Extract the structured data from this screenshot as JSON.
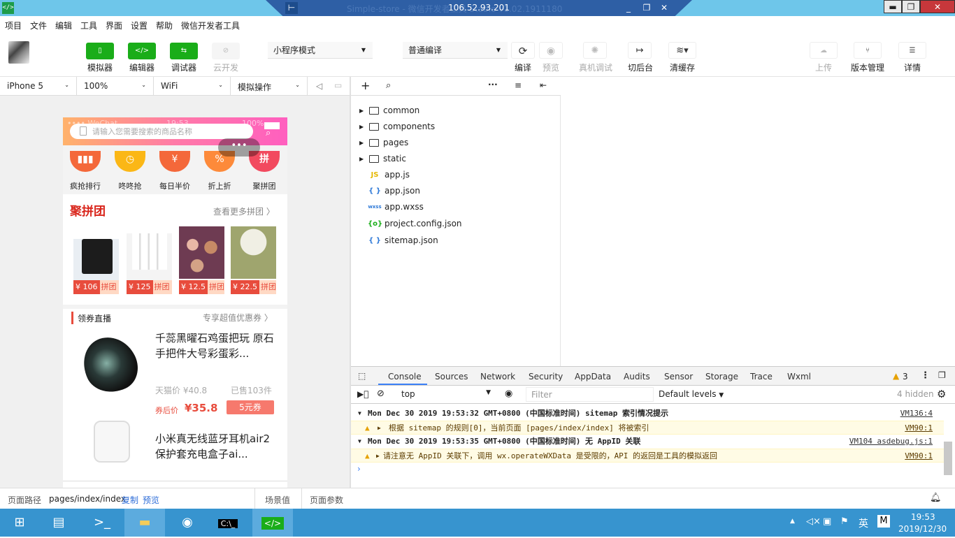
{
  "titlebar": {
    "app_icon": "</>",
    "ghost_title": "Simple-store - 微信开发者工具 Stable v1.02.1911180",
    "rdp_ip": "106.52.93.201",
    "pin_icon": "pin-icon"
  },
  "menu": [
    "项目",
    "文件",
    "编辑",
    "工具",
    "界面",
    "设置",
    "帮助",
    "微信开发者工具"
  ],
  "toolbar": {
    "simulator": "模拟器",
    "editor": "编辑器",
    "debugger": "调试器",
    "cloud": "云开发",
    "mode": "小程序模式",
    "compile_mode": "普通编译",
    "compile": "编译",
    "preview": "预览",
    "remote_debug": "真机调试",
    "background": "切后台",
    "clear_cache": "清缓存",
    "upload": "上传",
    "version": "版本管理",
    "details": "详情"
  },
  "device": {
    "model": "iPhone 5",
    "zoom": "100%",
    "network": "WiFi",
    "operation": "模拟操作"
  },
  "phone": {
    "status_carrier": "•••• WeChat",
    "status_time": "19:53",
    "status_battery": "100%",
    "search_placeholder": "请输入您需要搜索的商品名称",
    "capsule": "•••",
    "categories": [
      {
        "label": "疯抢排行",
        "icon": "fire-icon",
        "color": "#f4683a"
      },
      {
        "label": "咚咚抢",
        "icon": "clock-icon",
        "color": "#fbb716"
      },
      {
        "label": "每日半价",
        "icon": "yen-icon",
        "color": "#f4683a"
      },
      {
        "label": "折上折",
        "icon": "discount-icon",
        "color": "#fd8a3a"
      },
      {
        "label": "聚拼团",
        "icon": "group-icon",
        "color": "#f24a5f"
      }
    ],
    "group_title": "聚拼团",
    "group_more": "查看更多拼团 〉",
    "products": [
      {
        "price": "¥ 106",
        "tag": "拼团",
        "bg": "#e9eef3"
      },
      {
        "price": "¥ 125",
        "tag": "拼团",
        "bg": "#f4f4f4"
      },
      {
        "price": "¥ 12.5",
        "tag": "拼团",
        "bg": "#c9a88a"
      },
      {
        "price": "¥ 22.5",
        "tag": "拼团",
        "bg": "#9fa56e"
      }
    ],
    "live_title": "领券直播",
    "live_more": "专享超值优惠券 〉",
    "item1": {
      "title": "千蕊黑曜石鸡蛋把玩 原石手把件大号彩蛋彩...",
      "tmall": "天猫价 ¥40.8",
      "sold": "已售103件",
      "after_label": "券后价",
      "after_price": "¥35.8",
      "coupon": "5元券"
    },
    "item2": {
      "title": "小米真无线蓝牙耳机air2保护套充电盒子ai..."
    }
  },
  "tree": [
    {
      "type": "folder",
      "name": "common"
    },
    {
      "type": "folder",
      "name": "components"
    },
    {
      "type": "folder",
      "name": "pages"
    },
    {
      "type": "folder",
      "name": "static"
    },
    {
      "type": "file",
      "name": "app.js",
      "icon": "JS",
      "color": "#e6b800"
    },
    {
      "type": "file",
      "name": "app.json",
      "icon": "{ }",
      "color": "#2f7ad8"
    },
    {
      "type": "file",
      "name": "app.wxss",
      "icon": "wxss",
      "color": "#2f7ad8"
    },
    {
      "type": "file",
      "name": "project.config.json",
      "icon": "{o}",
      "color": "#1aad19"
    },
    {
      "type": "file",
      "name": "sitemap.json",
      "icon": "{ }",
      "color": "#2f7ad8"
    }
  ],
  "devtools": {
    "tabs": [
      "Console",
      "Sources",
      "Network",
      "Security",
      "AppData",
      "Audits",
      "Sensor",
      "Storage",
      "Trace",
      "Wxml"
    ],
    "warn_count": "3",
    "context": "top",
    "filter_placeholder": "Filter",
    "levels": "Default levels",
    "hidden": "4 hidden",
    "logs": [
      {
        "kind": "group",
        "text": "Mon Dec 30 2019 19:53:32 GMT+0800 (中国标准时间) sitemap 索引情况提示",
        "src": "VM136:4"
      },
      {
        "kind": "warn",
        "text": "根据 sitemap 的规则[0]，当前页面 [pages/index/index] 将被索引",
        "src": "VM90:1"
      },
      {
        "kind": "group",
        "text": "Mon Dec 30 2019 19:53:35 GMT+0800 (中国标准时间) 无 AppID 关联",
        "src": "VM104 asdebug.js:1"
      },
      {
        "kind": "warn",
        "text": "请注意无 AppID 关联下，调用 wx.operateWXData 是受限的，API 的返回是工具的模拟返回",
        "src": "VM90:1"
      }
    ]
  },
  "statusbar": {
    "path_label": "页面路径",
    "path": "pages/index/index",
    "copy": "复制",
    "preview": "预览",
    "scene": "场景值",
    "params": "页面参数"
  },
  "taskbar": {
    "time": "19:53",
    "date": "2019/12/30",
    "ime": "英",
    "ime2": "M"
  }
}
